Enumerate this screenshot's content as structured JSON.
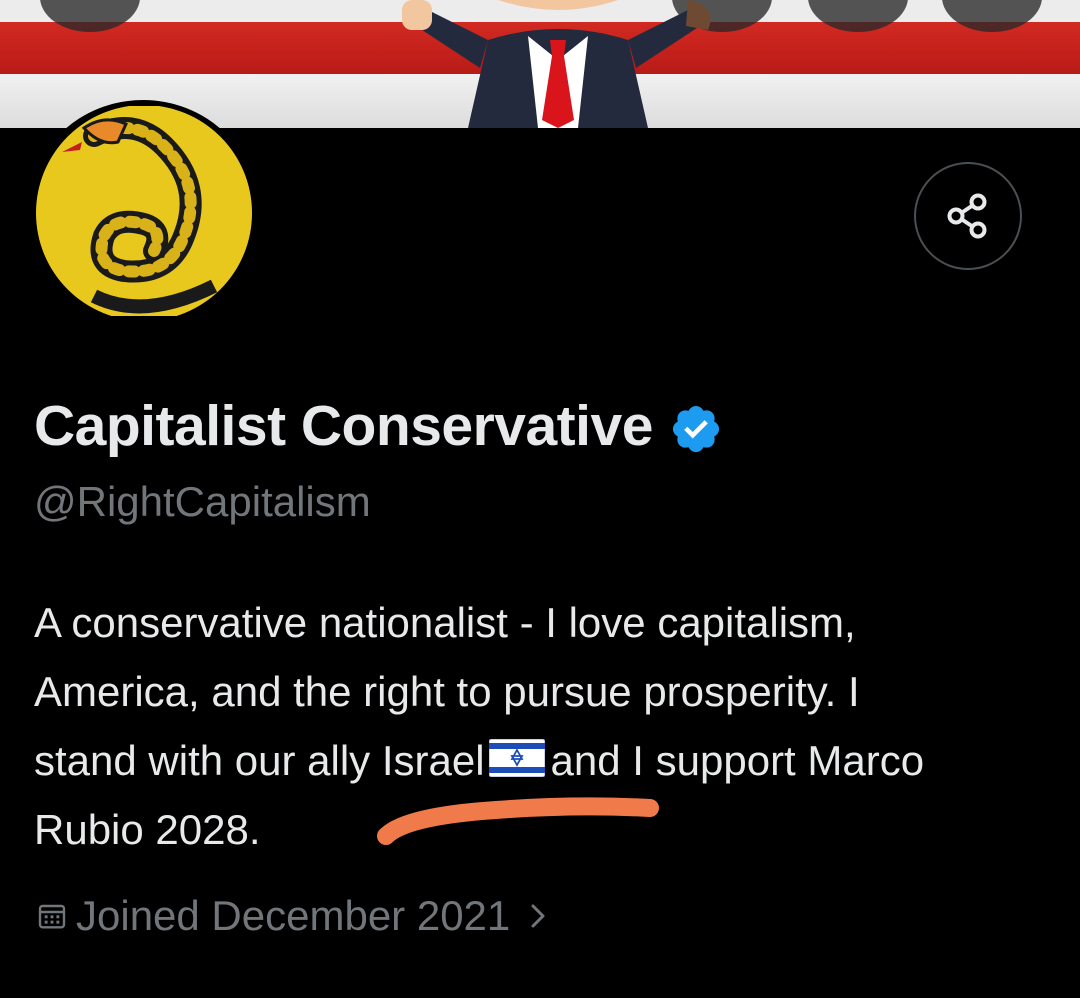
{
  "profile": {
    "display_name": "Capitalist Conservative",
    "handle": "@RightCapitalism",
    "verified": true,
    "bio_line1": "A conservative nationalist - I love capitalism,",
    "bio_line2": "America, and the right to pursue prosperity. I",
    "bio_line3a": "stand with our ally Israel",
    "bio_line3b": "and I support Marco",
    "bio_line4": "Rubio 2028.",
    "joined": "Joined December 2021"
  },
  "icons": {
    "share": "share-icon",
    "verified": "verified-badge-icon",
    "calendar": "calendar-icon",
    "chevron": "chevron-right-icon",
    "flag": "israel-flag-emoji"
  },
  "colors": {
    "background": "#000000",
    "primary_text": "#e7e9ea",
    "secondary_text": "#71767b",
    "verified_blue": "#1d9bf0",
    "annotation_orange": "#f07a4a",
    "avatar_yellow": "#e9c81e"
  }
}
